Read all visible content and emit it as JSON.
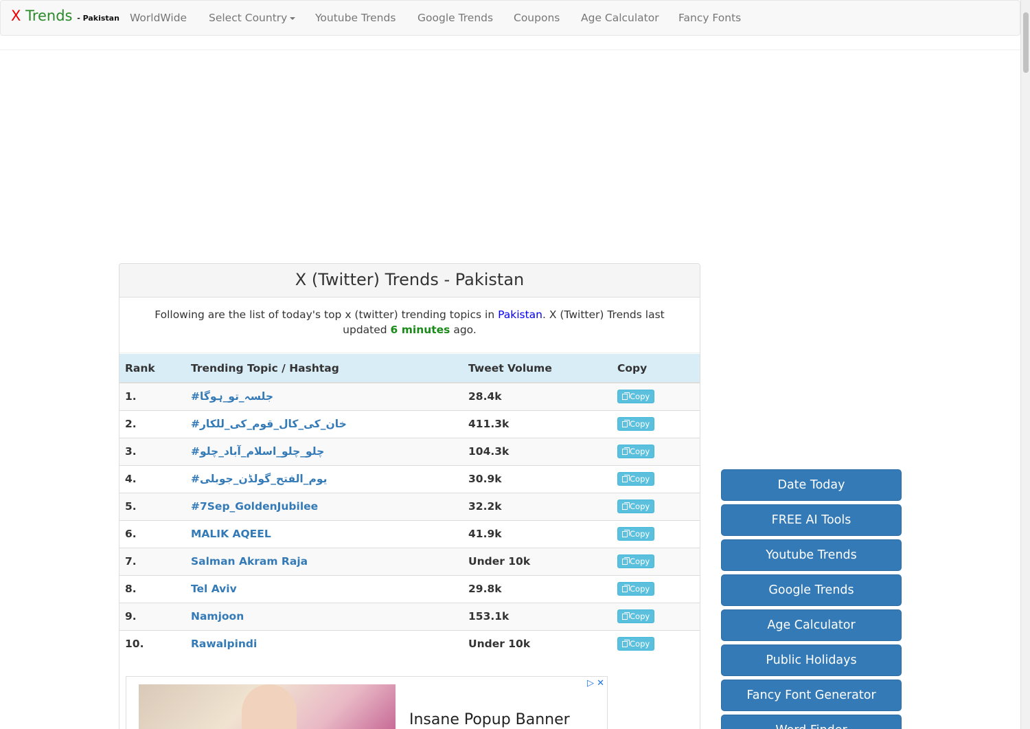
{
  "nav": {
    "brand_x": "X",
    "brand_trends": "Trends",
    "brand_country": "- Pakistan",
    "items": [
      "WorldWide",
      "Select Country",
      "Youtube Trends",
      "Google Trends",
      "Coupons",
      "Age Calculator",
      "Fancy Fonts"
    ]
  },
  "panel": {
    "title": "X (Twitter) Trends - Pakistan",
    "intro_pre": "Following are the list of today's top x (twitter) trending topics in ",
    "intro_country": "Pakistan",
    "intro_mid": ". X (Twitter) Trends last updated ",
    "intro_updated": "6 minutes",
    "intro_post": " ago."
  },
  "table": {
    "headers": [
      "Rank",
      "Trending Topic / Hashtag",
      "Tweet Volume",
      "Copy"
    ],
    "copy_label": "Copy",
    "rows": [
      {
        "rank": "1.",
        "topic": "#جلسہ_تو_ہوگا",
        "volume": "28.4k"
      },
      {
        "rank": "2.",
        "topic": "#خان_کی_کال_قوم_کی_للکار",
        "volume": "411.3k"
      },
      {
        "rank": "3.",
        "topic": "#چلو_چلو_اسلام_آباد_چلو",
        "volume": "104.3k"
      },
      {
        "rank": "4.",
        "topic": "#یوم_الفتح_گولڈن_جوبلی",
        "volume": "30.9k"
      },
      {
        "rank": "5.",
        "topic": "#7Sep_GoldenJubilee",
        "volume": "32.2k"
      },
      {
        "rank": "6.",
        "topic": "MALIK AQEEL",
        "volume": "41.9k"
      },
      {
        "rank": "7.",
        "topic": "Salman Akram Raja",
        "volume": "Under 10k"
      },
      {
        "rank": "8.",
        "topic": "Tel Aviv",
        "volume": "29.8k"
      },
      {
        "rank": "9.",
        "topic": "Namjoon",
        "volume": "153.1k"
      },
      {
        "rank": "10.",
        "topic": "Rawalpindi",
        "volume": "Under 10k"
      }
    ]
  },
  "ad": {
    "text": "Insane Popup Banner",
    "icons": "▷ ✕"
  },
  "sidebar": {
    "buttons": [
      "Date Today",
      "FREE AI Tools",
      "Youtube Trends",
      "Google Trends",
      "Age Calculator",
      "Public Holidays",
      "Fancy Font Generator",
      "Word Finder"
    ]
  }
}
